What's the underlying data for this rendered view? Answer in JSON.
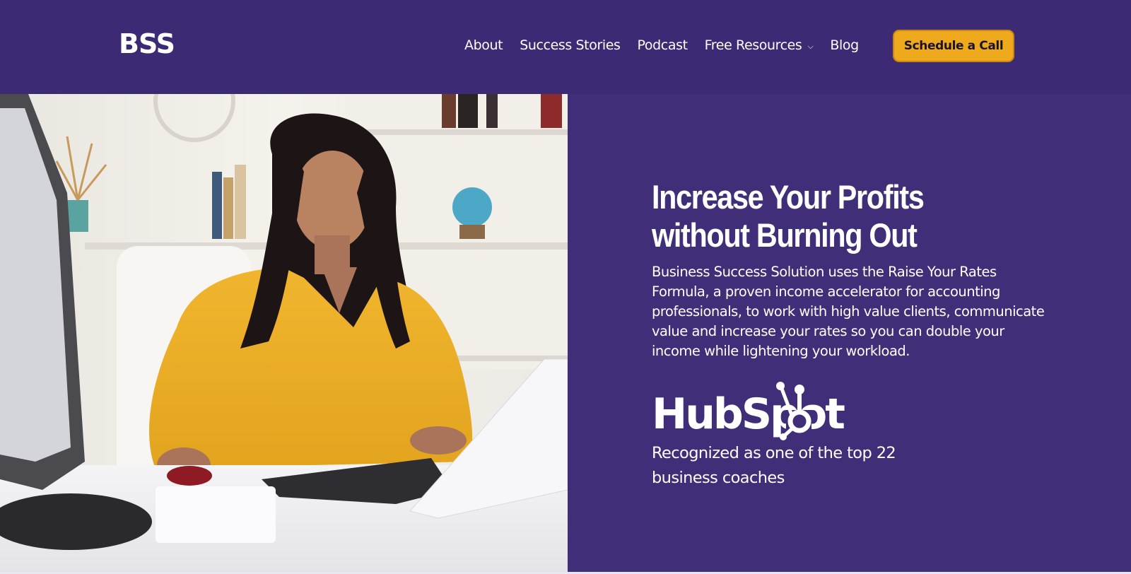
{
  "header": {
    "logo": "BSS",
    "nav": [
      {
        "label": "About"
      },
      {
        "label": "Success Stories"
      },
      {
        "label": "Podcast"
      },
      {
        "label": "Free Resources",
        "has_dropdown": true,
        "dropdown_icon": "chevron-down-icon"
      },
      {
        "label": "Blog"
      }
    ],
    "cta_label": "Schedule a Call"
  },
  "hero": {
    "image_alt": "Woman in a yellow blouse working at a laptop in a bright office",
    "headline": "Increase Your Profits without Burning Out",
    "body": "Business Success Solution uses the Raise Your Rates Formula, a proven income accelerator for accounting professionals, to work with high value clients, communicate value and increase your rates so you can double your income while lightening your workload.",
    "badge_logo": "HubSpot",
    "badge_text": "Recognized as one of the top 22 business coaches"
  },
  "colors": {
    "header_bg": "#3c2b74",
    "panel_bg": "#412e79",
    "cta_bg": "#eea91c",
    "cta_border": "#c98612",
    "text": "#ffffff"
  }
}
